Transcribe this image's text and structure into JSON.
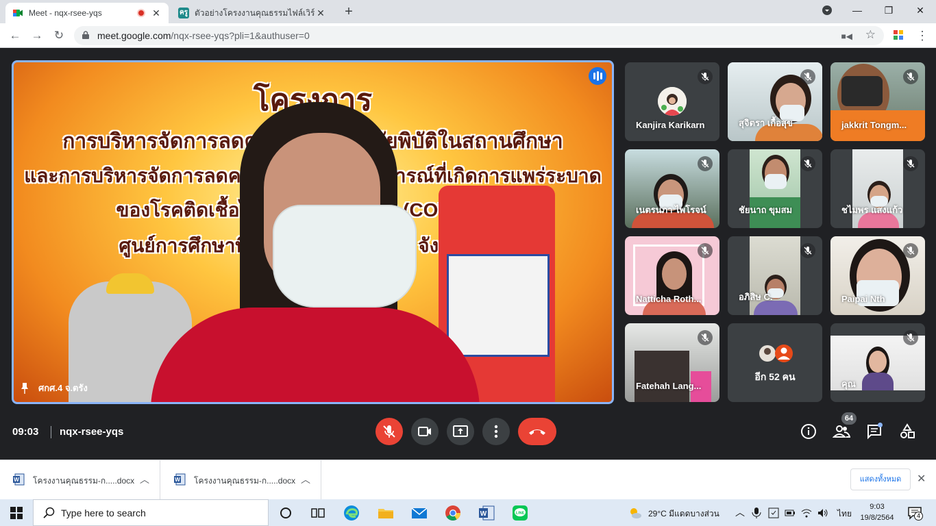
{
  "browser": {
    "tabs": [
      {
        "title": "Meet - nqx-rsee-yqs",
        "recording": true
      },
      {
        "title": "ตัวอย่างโครงงานคุณธรรมไฟล์เวิร์ด - ครู"
      }
    ],
    "new_tab_symbol": "+",
    "window_controls": {
      "minimize": "—",
      "maximize": "❐",
      "close": "✕"
    },
    "url_host": "meet.google.com",
    "url_path": "/nqx-rsee-yqs?pli=1&authuser=0"
  },
  "meet": {
    "presenter": {
      "name": "ศกศ.4 จ.ตรัง",
      "slide_lines": [
        "โครงการ",
        "การบริหารจัดการลดความเสี่ยงจากภัยพิบัติในสถานศึกษา",
        "และการบริหารจัดการลดความเสี่ยงในสถานการณ์ที่เกิดการแพร่ระบาด",
        "ของโรคติดเชื้อไวรัสโคโรนา 2019 (COVID -19)",
        "ศูนย์การศึกษาพิเศษ เขตการศึกษา 4 จังหวัดตรัง"
      ]
    },
    "participants": [
      {
        "name": "Kanjira Karikarn",
        "type": "avatar"
      },
      {
        "name": "สุจิตรา เกื้อสุข",
        "type": "video"
      },
      {
        "name": "jakkrit Tongm...",
        "type": "video"
      },
      {
        "name": "เนตรนภา ไพโรจน์",
        "type": "video"
      },
      {
        "name": "ชัยนาถ ขุมสม",
        "type": "video"
      },
      {
        "name": "ชไมพร แสงแก้ว",
        "type": "video"
      },
      {
        "name": "Natticha Roth...",
        "type": "video"
      },
      {
        "name": "อภิสิษ C.",
        "type": "video"
      },
      {
        "name": "Paipai Nth",
        "type": "video"
      },
      {
        "name": "Fatehah Lang...",
        "type": "video"
      },
      {
        "name": "อีก 52 คน",
        "type": "others"
      },
      {
        "name": "คุณ",
        "type": "self"
      }
    ],
    "time": "09:03",
    "meeting_code": "nqx-rsee-yqs",
    "participant_count": "64",
    "colors": {
      "accent": "#1a73e8",
      "danger": "#ea4335",
      "bg": "#202124"
    }
  },
  "downloads": {
    "items": [
      {
        "file": "โครงงานคุณธรรม-ก.....docx"
      },
      {
        "file": "โครงงานคุณธรรม-ก.....docx"
      }
    ],
    "show_all": "แสดงทั้งหมด"
  },
  "taskbar": {
    "search_placeholder": "Type here to search",
    "weather": "29°C  มีแดดบางส่วน",
    "language": "ไทย",
    "time": "9:03",
    "date": "19/8/2564",
    "notifications": "4"
  }
}
